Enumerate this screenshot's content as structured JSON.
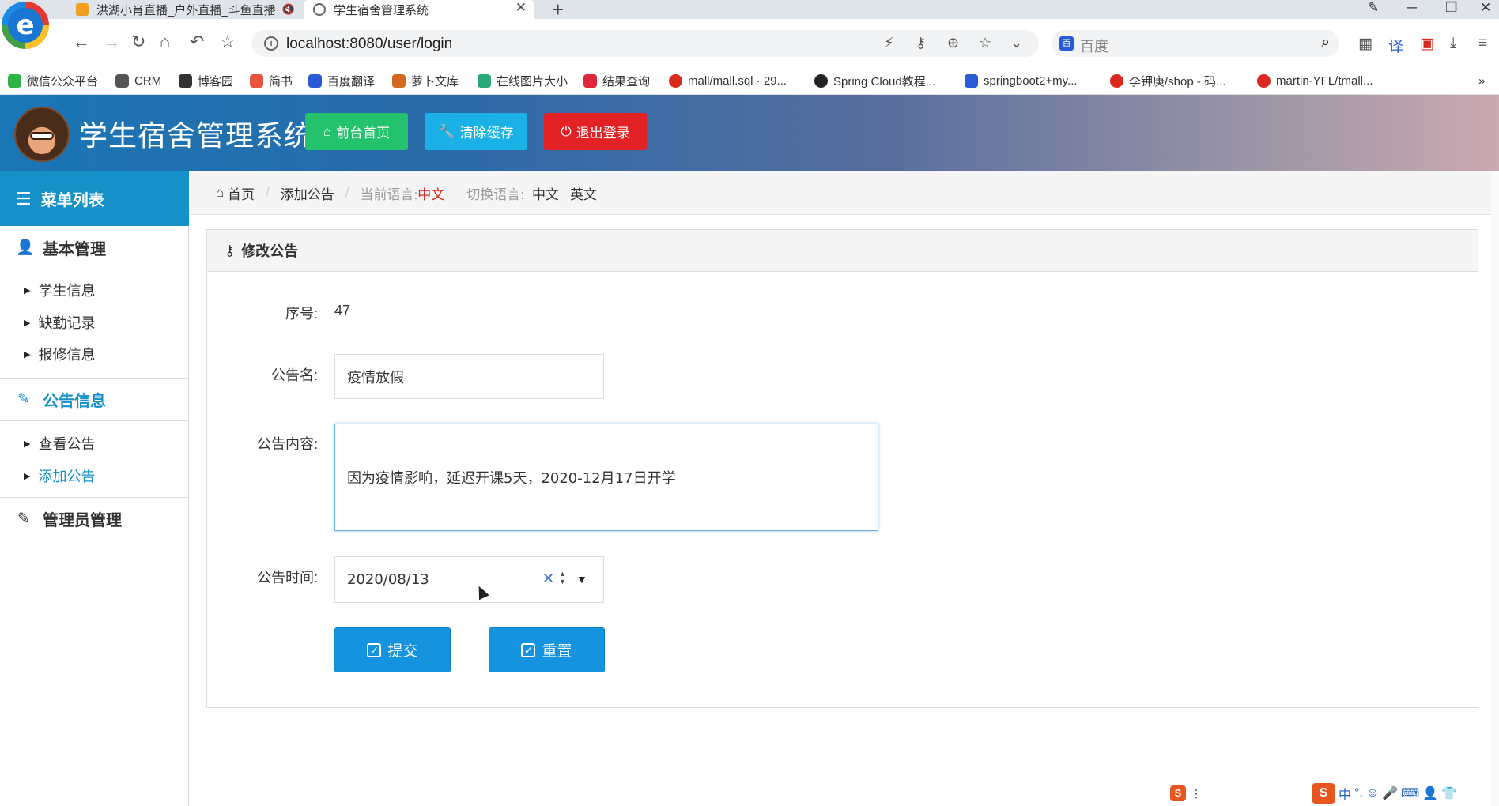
{
  "browser": {
    "tabs": [
      {
        "title": "洪湖小肖直播_户外直播_斗鱼直播",
        "active": false
      },
      {
        "title": "学生宿舍管理系统",
        "active": true
      }
    ],
    "url": "localhost:8080/user/login",
    "search_placeholder": "百度",
    "bookmarks": [
      {
        "label": "微信公众平台",
        "color": "#2fb344"
      },
      {
        "label": "CRM",
        "color": "#555555"
      },
      {
        "label": "博客园",
        "color": "#333333"
      },
      {
        "label": "简书",
        "color": "#e8533d"
      },
      {
        "label": "百度翻译",
        "color": "#2a5bd7"
      },
      {
        "label": "萝卜文库",
        "color": "#d2691e"
      },
      {
        "label": "在线图片大小",
        "color": "#2aa876"
      },
      {
        "label": "结果查询",
        "color": "#e0283a"
      },
      {
        "label": "mall/mall.sql · 29...",
        "color": "#d9281e"
      },
      {
        "label": "Spring Cloud教程...",
        "color": "#222222"
      },
      {
        "label": "springboot2+my...",
        "color": "#2a5bd7"
      },
      {
        "label": "李钾庚/shop - 码...",
        "color": "#d9281e"
      },
      {
        "label": "martin-YFL/tmall...",
        "color": "#d9281e"
      }
    ]
  },
  "header": {
    "title": "学生宿舍管理系统",
    "home_label": "前台首页",
    "cache_label": "清除缓存",
    "logout_label": "退出登录"
  },
  "sidebar": {
    "menu_title": "菜单列表",
    "groups": [
      {
        "label": "基本管理",
        "items": [
          "学生信息",
          "缺勤记录",
          "报修信息"
        ]
      },
      {
        "label": "公告信息",
        "items": [
          "查看公告",
          "添加公告"
        ]
      },
      {
        "label": "管理员管理",
        "items": []
      }
    ],
    "active_group": "公告信息",
    "active_item": "添加公告"
  },
  "breadcrumb": {
    "home": "首页",
    "page": "添加公告",
    "current_lang_label": "当前语言:",
    "current_lang": "中文",
    "switch_label": "切换语言:",
    "lang_zh": "中文",
    "lang_en": "英文"
  },
  "form": {
    "panel_title": "修改公告",
    "id_label": "序号:",
    "id_value": "47",
    "name_label": "公告名:",
    "name_value": "疫情放假",
    "content_label": "公告内容:",
    "content_value": "因为疫情影响，延迟开课5天，2020-12月17日开学",
    "time_label": "公告时间:",
    "time_value": "2020/08/13",
    "submit_label": "提交",
    "reset_label": "重置"
  },
  "colors": {
    "primary": "#1593de",
    "menu_header": "#1590c8",
    "home_button": "#25c26e",
    "cache_button": "#1bb1e6",
    "logout_button": "#e32225",
    "current_lang": "#d9281e"
  },
  "ime": {
    "label": "中"
  }
}
